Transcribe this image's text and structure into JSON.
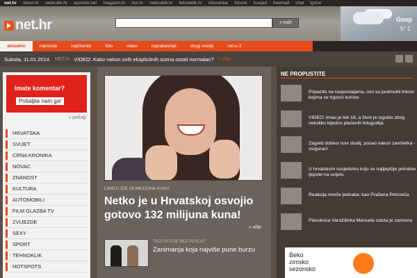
{
  "top_strip": [
    "net.hr",
    "dnevi.hr",
    "webcafe.hr",
    "sportski.net",
    "magazin.hr",
    "hot.hr",
    "netmobili.hr",
    "tehnoklik.hr",
    "infocentar",
    "forumi",
    "trusjed",
    "freemail",
    "chat",
    "igrice"
  ],
  "header": {
    "logo_text": "net.hr",
    "search_placeholder": "",
    "search_button": "» traži",
    "weather_city": "Gosp",
    "weather_temp": "5°  1"
  },
  "nav": [
    "aktualno",
    "najnovije",
    "najčitanije",
    "foto",
    "video",
    "najzabavnije",
    "drugi mediji",
    "net.e-3"
  ],
  "datebar": {
    "date": "Subota, 11.01.2014.",
    "ticker_source": "NET.hr",
    "ticker": "VIDEO: Kako nakon ovih eksplicitnih scena ostati normalan?",
    "more": "» više"
  },
  "left": {
    "comment_title": "Imate komentar?",
    "comment_button": "Pošaljite nam ga!",
    "posalji": "» pošalji",
    "menu": [
      "HRVATSKA",
      "SVIJET",
      "CRNA KRONIKA",
      "NOVAC",
      "ZNANOST",
      "KULTURA",
      "AUTOMOBILI",
      "FILM GLAZBA TV",
      "ZVIJEZDE",
      "SEXY",
      "SPORT",
      "TEHNOKLIK",
      "HOTSPOTS"
    ]
  },
  "center": {
    "hero_kicker": "LINICU IDE 26 MILIJUNA KUNA",
    "hero_title": "Netko je u Hrvatskoj osvojio gotovo 132 milijuna kuna!",
    "hero_more": "» više",
    "second_kicker": "TKO OSTAJE BEZ POSLA?",
    "second_title": "Zanimanja koja najviše pune burzu"
  },
  "right": {
    "heading": "NE PROPUSTITE",
    "items": [
      {
        "kicker": "",
        "text": "Pripazite na raspordajama, ovo su podmukli trikovi kojima se trgovci koriste"
      },
      {
        "kicker": "",
        "text": "VIDEO: Imao je tek 18, a život je izgubio zbog nekoliko bijedno plaćenih fotografija"
      },
      {
        "kicker": "",
        "text": "Zagreb dobiva novi studij, posao nakon završetka - osiguran!"
      },
      {
        "kicker": "",
        "text": "U hrvatskom susjedstvu kriju se najljepšije prirodne ljepote na svijetu"
      },
      {
        "kicker": "",
        "text": "Reakcija mreže jednaka: kao Pražena Petrovića"
      },
      {
        "kicker": "",
        "text": "Plavokosa Varaždinka Manuela zaista je zanosna"
      }
    ]
  },
  "ad": {
    "text1": "Beko",
    "text2": "zimsko",
    "text3": "sezonsko"
  }
}
